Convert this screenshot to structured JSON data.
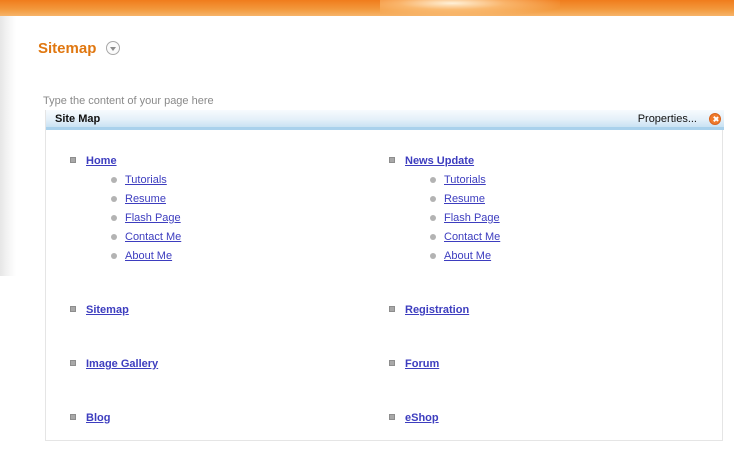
{
  "header": {
    "title": "Sitemap"
  },
  "hint": "Type the content of your page here",
  "panel": {
    "title": "Site Map",
    "properties_label": "Properties..."
  },
  "columns": [
    {
      "groups": [
        {
          "label": "Home",
          "children": [
            "Tutorials",
            "Resume",
            "Flash Page",
            "Contact Me",
            "About Me"
          ]
        },
        {
          "label": "Sitemap",
          "children": []
        },
        {
          "label": "Image Gallery",
          "children": []
        },
        {
          "label": "Blog",
          "children": []
        }
      ]
    },
    {
      "groups": [
        {
          "label": "News Update",
          "children": [
            "Tutorials",
            "Resume",
            "Flash Page",
            "Contact Me",
            "About Me"
          ]
        },
        {
          "label": "Registration",
          "children": []
        },
        {
          "label": "Forum",
          "children": []
        },
        {
          "label": "eShop",
          "children": []
        }
      ]
    }
  ],
  "colors": {
    "accent": "#e07710",
    "link": "#3d3dbf",
    "header_bar": "#c9e2f3"
  }
}
